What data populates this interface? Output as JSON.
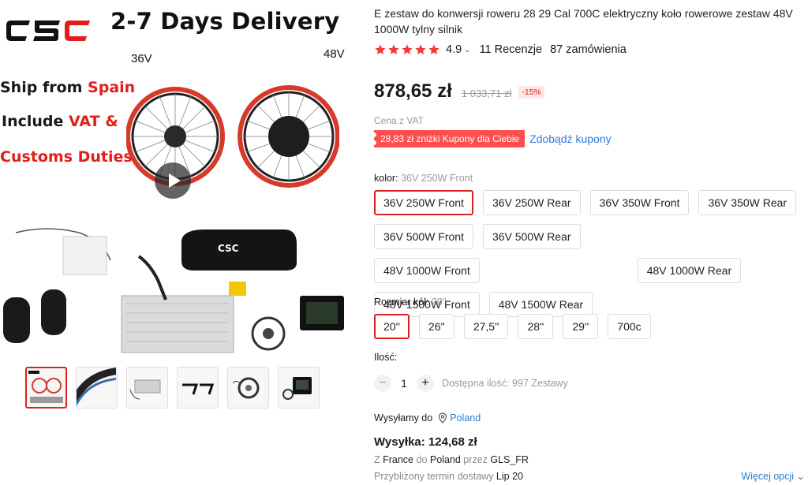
{
  "gallery": {
    "logo_text": "CSC",
    "delivery_title": "2-7 Days Delivery",
    "label_36v": "36V",
    "label_48v": "48V",
    "promo_ship_prefix": "Ship from ",
    "promo_ship_country": "Spain",
    "promo_include_prefix": "Include ",
    "promo_include_vat": "VAT &",
    "promo_customs": "Customs Duties",
    "thumbnails": [
      "main",
      "tire",
      "controller",
      "brake-levers",
      "sensor",
      "display"
    ]
  },
  "product": {
    "title": "E zestaw do konwersji roweru 28 29 Cal 700C elektryczny koło rowerowe zestaw 48V 1000W tylny silnik",
    "rating": "4.9",
    "rating_chevron": "⌄",
    "reviews": "11 Recenzje",
    "orders": "87 zamówienia",
    "price": "878,65 zł",
    "old_price": "1 033,71 zł",
    "discount": "-15%",
    "vat_note": "Cena z VAT",
    "coupon_tag": "28,83 zł zniżki Kupony dla Ciebie",
    "coupon_link": "Zdobądź kupony"
  },
  "options": {
    "color_label": "kolor:",
    "color_selected": "36V 250W Front",
    "colors": [
      "36V 250W Front",
      "36V 250W Rear",
      "36V 350W Front",
      "36V 350W Rear",
      "36V 500W Front",
      "36V 500W Rear",
      "48V 1000W Front",
      "48V 1000W Rear",
      "48V 1500W Front",
      "48V 1500W Rear"
    ],
    "size_label": "Rozmiar kół:",
    "size_selected": "20''",
    "sizes": [
      "20''",
      "26''",
      "27,5''",
      "28''",
      "29''",
      "700c"
    ]
  },
  "quantity": {
    "label": "Ilość:",
    "minus": "−",
    "value": "1",
    "plus": "+",
    "stock": "Dostępna ilość: 997 Zestawy"
  },
  "shipping": {
    "ship_to_label": "Wysyłamy do",
    "ship_to_country": "Poland",
    "price": "Wysyłka: 124,68 zł",
    "route_z": "Z ",
    "route_from": "France",
    "route_do": " do ",
    "route_to": "Poland",
    "route_przez": " przez ",
    "route_carrier": "GLS_FR",
    "eta_label": "Przybliżony termin dostawy ",
    "eta_date": "Lip 20",
    "more_options": "Więcej opcji",
    "more_chevron": "⌄"
  },
  "colors": {
    "accent_red": "#e02020",
    "coupon_red": "#ff4e4e",
    "link_blue": "#2e7ad1",
    "star_red": "#f23c3c"
  }
}
